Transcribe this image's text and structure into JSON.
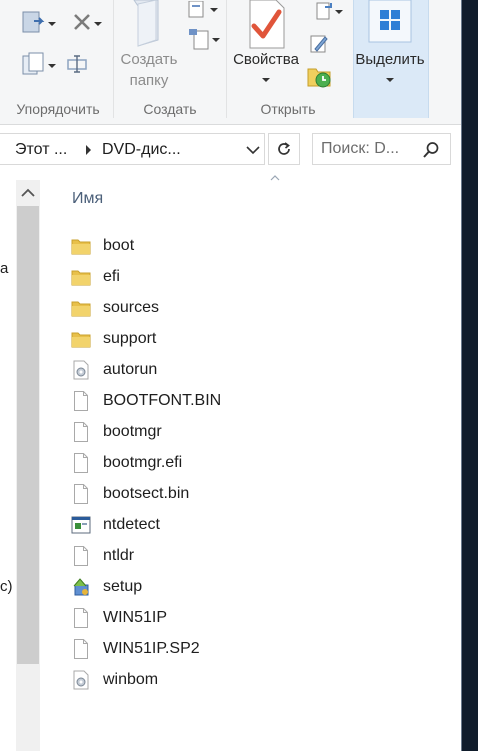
{
  "ribbon": {
    "groups": {
      "organize": "Упорядочить",
      "create": "Создать",
      "open": "Открыть"
    },
    "new_folder_line1": "Создать",
    "new_folder_line2": "папку",
    "properties_label": "Свойства",
    "select_label": "Выделить"
  },
  "address": {
    "crumbs": [
      "Этот ...",
      "DVD-дис..."
    ],
    "search_placeholder": "Поиск: D..."
  },
  "nav": {
    "fragments": [
      "а",
      "с)"
    ]
  },
  "filelist": {
    "column_name": "Имя",
    "files": [
      {
        "name": "boot",
        "icon": "folder-icon"
      },
      {
        "name": "efi",
        "icon": "folder-icon"
      },
      {
        "name": "sources",
        "icon": "folder-icon"
      },
      {
        "name": "support",
        "icon": "folder-icon"
      },
      {
        "name": "autorun",
        "icon": "settings-file-icon"
      },
      {
        "name": "BOOTFONT.BIN",
        "icon": "file-icon"
      },
      {
        "name": "bootmgr",
        "icon": "file-icon"
      },
      {
        "name": "bootmgr.efi",
        "icon": "file-icon"
      },
      {
        "name": "bootsect.bin",
        "icon": "file-icon"
      },
      {
        "name": "ntdetect",
        "icon": "application-icon"
      },
      {
        "name": "ntldr",
        "icon": "file-icon"
      },
      {
        "name": "setup",
        "icon": "setup-icon"
      },
      {
        "name": "WIN51IP",
        "icon": "file-icon"
      },
      {
        "name": "WIN51IP.SP2",
        "icon": "file-icon"
      },
      {
        "name": "winbom",
        "icon": "settings-file-icon"
      }
    ]
  },
  "colors": {
    "ribbon_bg": "#f5f6f7",
    "select_highlight": "#dbe9f7",
    "folder": "#e8c04a",
    "header_text": "#4c607a"
  }
}
